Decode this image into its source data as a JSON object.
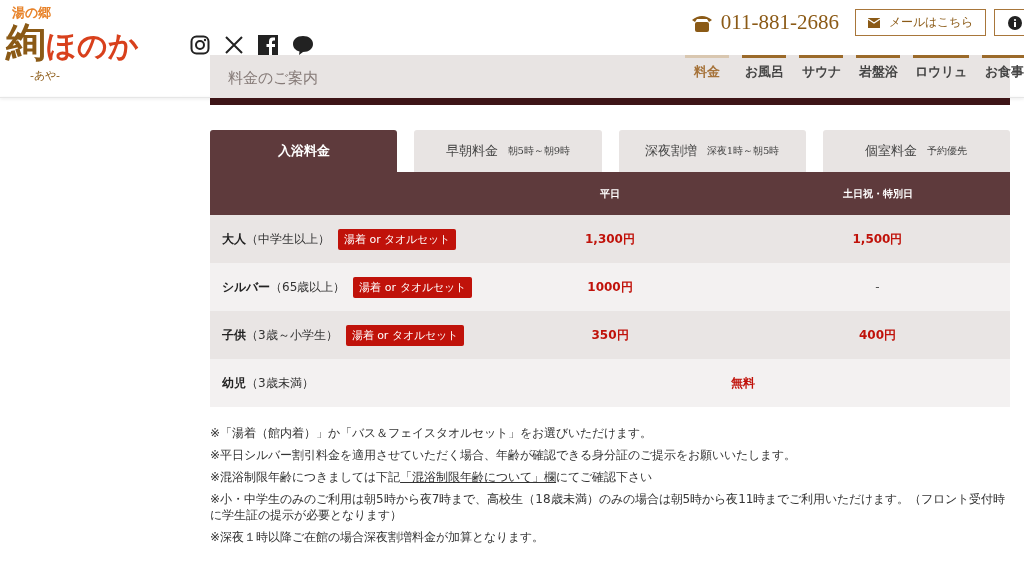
{
  "logo": {
    "top": "湯の郷",
    "main_kanji": "絢",
    "main_kana": "ほのか",
    "reading": "-あや-"
  },
  "header": {
    "phone": "011-881-2686",
    "mail_button": "メールはこちら"
  },
  "page_title": "料金のご案内",
  "nav": [
    {
      "label": "料金",
      "selected": true
    },
    {
      "label": "お風呂",
      "selected": false
    },
    {
      "label": "サウナ",
      "selected": false
    },
    {
      "label": "岩盤浴",
      "selected": false
    },
    {
      "label": "ロウリュ",
      "selected": false
    },
    {
      "label": "お食事",
      "selected": false
    }
  ],
  "tabs": [
    {
      "label": "入浴料金",
      "selected": true
    },
    {
      "label": "早朝料金",
      "sub": "朝5時～朝9時",
      "selected": false
    },
    {
      "label": "深夜割増",
      "sub": "深夜1時～朝5時",
      "selected": false
    },
    {
      "label": "個室料金",
      "sub": "予約優先",
      "selected": false
    }
  ],
  "table": {
    "columns": [
      "平日",
      "土日祝・特別日"
    ],
    "rows": [
      {
        "kind": "split",
        "name": "大人",
        "note": "（中学生以上）",
        "badge": "湯着 or タオルセット",
        "weekday": "1,300円",
        "weekend": "1,500円"
      },
      {
        "kind": "split",
        "name": "シルバー",
        "note": "（65歳以上）",
        "badge": "湯着 or タオルセット",
        "weekday": "1000円",
        "weekend": "-"
      },
      {
        "kind": "split",
        "name": "子供",
        "note": "（3歳～小学生）",
        "badge": "湯着 or タオルセット",
        "weekday": "350円",
        "weekend": "400円"
      },
      {
        "kind": "span",
        "name": "幼児",
        "note": "（3歳未満）",
        "price": "無料"
      }
    ]
  },
  "notes": [
    {
      "text": "※「湯着（館内着）」か「バス＆フェイスタオルセット」をお選びいただけます。"
    },
    {
      "text": "※平日シルバー割引料金を適用させていただく場合、年齢が確認できる身分証のご提示をお願いいたします。"
    },
    {
      "text": "※混浴制限年齢につきましては下記",
      "link": "「混浴制限年齢について」欄",
      "after": "にてご確認下さい"
    },
    {
      "text": "※小・中学生のみのご利用は朝5時から夜7時まで、高校生（18歳未満）のみの場合は朝5時から夜11時までご利用いただけます。（フロント受付時に学生証の提示が必要となります）"
    },
    {
      "text": "※深夜１時以降ご在館の場合深夜割増料金が加算となります。"
    }
  ]
}
